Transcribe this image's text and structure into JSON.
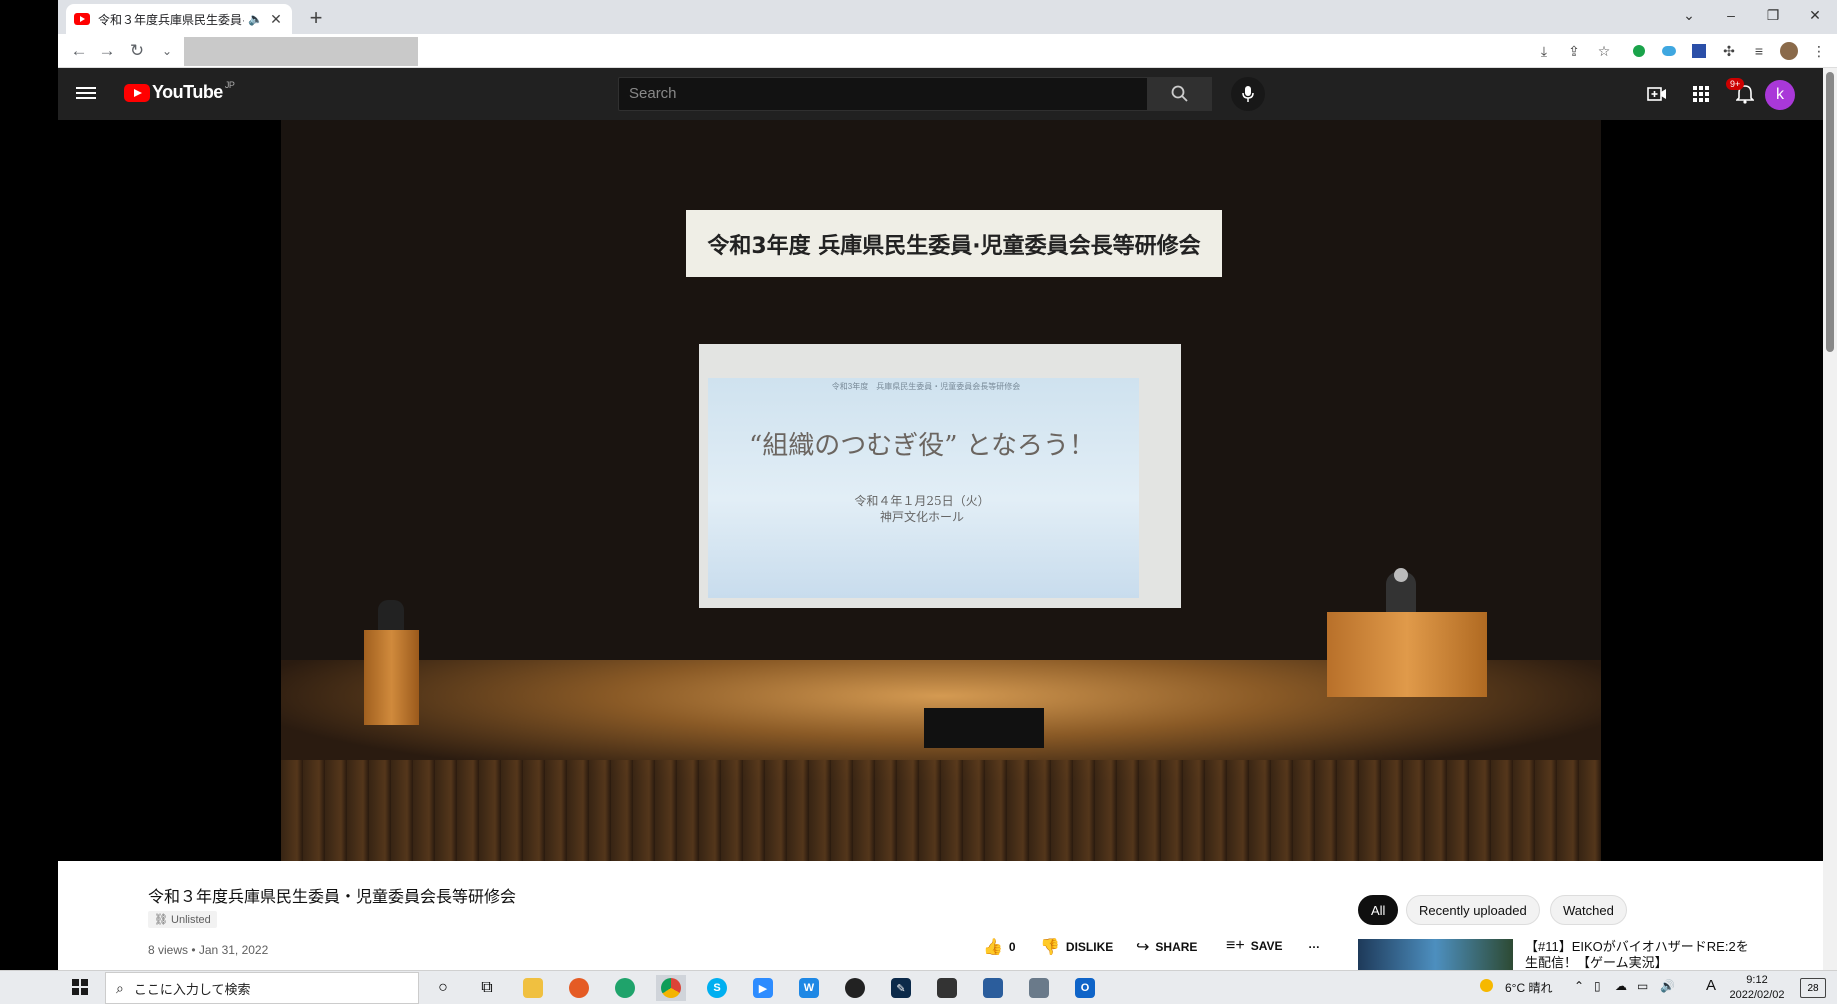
{
  "browser": {
    "tab_title": "令和３年度兵庫県民生委員·",
    "new_tab": "+",
    "controls": {
      "dropdown": "⌄",
      "minimize": "–",
      "restore": "❐",
      "close": "✕"
    }
  },
  "youtube": {
    "logo_text": "YouTube",
    "region": "JP",
    "search_placeholder": "Search",
    "notification_count": "9+",
    "avatar_letter": "k"
  },
  "video": {
    "banner": "令和3年度 兵庫県民生委員·児童委員会長等研修会",
    "slide_top": "令和3年度　兵庫県民生委員・児童委員会長等研修会",
    "slide_title": "“組織のつむぎ役” となろう！",
    "slide_date": "令和４年１月25日（火）",
    "slide_venue": "神戸文化ホール"
  },
  "info": {
    "title": "令和３年度兵庫県民生委員・児童委員会長等研修会",
    "visibility": "Unlisted",
    "views_date": "8 views • Jan 31, 2022",
    "like_count": "0",
    "dislike": "DISLIKE",
    "share": "SHARE",
    "save": "SAVE",
    "more": "…"
  },
  "chips": [
    "All",
    "Recently uploaded",
    "Watched"
  ],
  "recommendation": {
    "title": "【#11】EIKOがバイオハザードRE:2を生配信！【ゲーム実況】"
  },
  "taskbar": {
    "search_placeholder": "ここに入力して検索",
    "weather": "6°C  晴れ",
    "ime": "A",
    "time": "9:12",
    "date": "2022/02/02",
    "notification_count": "28"
  },
  "colors": {
    "youtube_red": "#ff0000",
    "avatar": "#a938d8",
    "masthead": "#212121"
  }
}
